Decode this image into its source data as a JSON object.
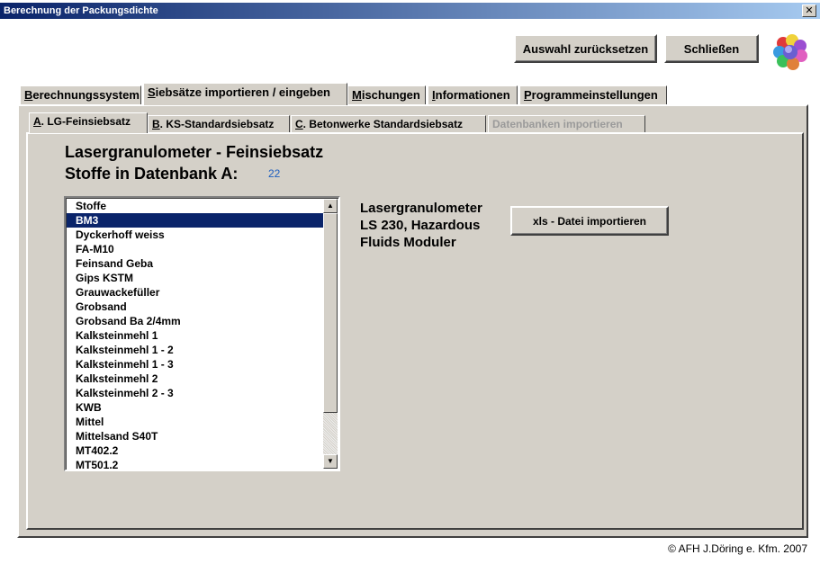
{
  "window": {
    "title": "Berechnung der Packungsdichte",
    "close_label": "✕"
  },
  "toolbar": {
    "reset_label": "Auswahl zurücksetzen",
    "close_label": "Schließen"
  },
  "main_tabs": [
    {
      "accel": "B",
      "rest": "erechnungssystem"
    },
    {
      "accel": "S",
      "rest": "iebsätze importieren / eingeben"
    },
    {
      "accel": "M",
      "rest": "ischungen"
    },
    {
      "accel": "I",
      "rest": "nformationen"
    },
    {
      "accel": "P",
      "rest": "rogrammeinstellungen"
    }
  ],
  "sub_tabs": [
    {
      "accel": "A",
      "rest": ". LG-Feinsiebsatz"
    },
    {
      "accel": "B",
      "rest": ". KS-Standardsiebsatz"
    },
    {
      "accel": "C",
      "rest": ". Betonwerke Standardsiebsatz"
    },
    {
      "label": "Datenbanken importieren"
    }
  ],
  "content": {
    "heading": "Lasergranulometer - Feinsiebsatz",
    "db_label": "Stoffe in Datenbank A:",
    "db_count": "22",
    "list_items": [
      "Stoffe",
      "BM3",
      "Dyckerhoff weiss",
      "FA-M10",
      "Feinsand Geba",
      "Gips KSTM",
      "Grauwackefüller",
      "Grobsand",
      "Grobsand Ba 2/4mm",
      "Kalksteinmehl 1",
      "Kalksteinmehl 1 - 2",
      "Kalksteinmehl 1 - 3",
      "Kalksteinmehl 2",
      "Kalksteinmehl 2 - 3",
      "KWB",
      "Mittel",
      "Mittelsand S40T",
      "MT402.2",
      "MT501.2"
    ],
    "selected_item": "BM3",
    "device_lines": [
      "Lasergranulometer",
      "LS 230, Hazardous",
      "Fluids Moduler"
    ],
    "import_button_label": "xls - Datei importieren"
  },
  "footer": {
    "copyright": "© AFH J.Döring e. Kfm. 2007"
  },
  "icons": {
    "logo": "molecule-logo-icon",
    "scroll_up": "arrow-up-icon",
    "scroll_down": "arrow-down-icon"
  },
  "colors": {
    "titlebar_start": "#0a246a",
    "titlebar_end": "#a6caf0",
    "selection": "#0a246a",
    "count": "#1f5fbf",
    "face": "#d4d0c8"
  }
}
